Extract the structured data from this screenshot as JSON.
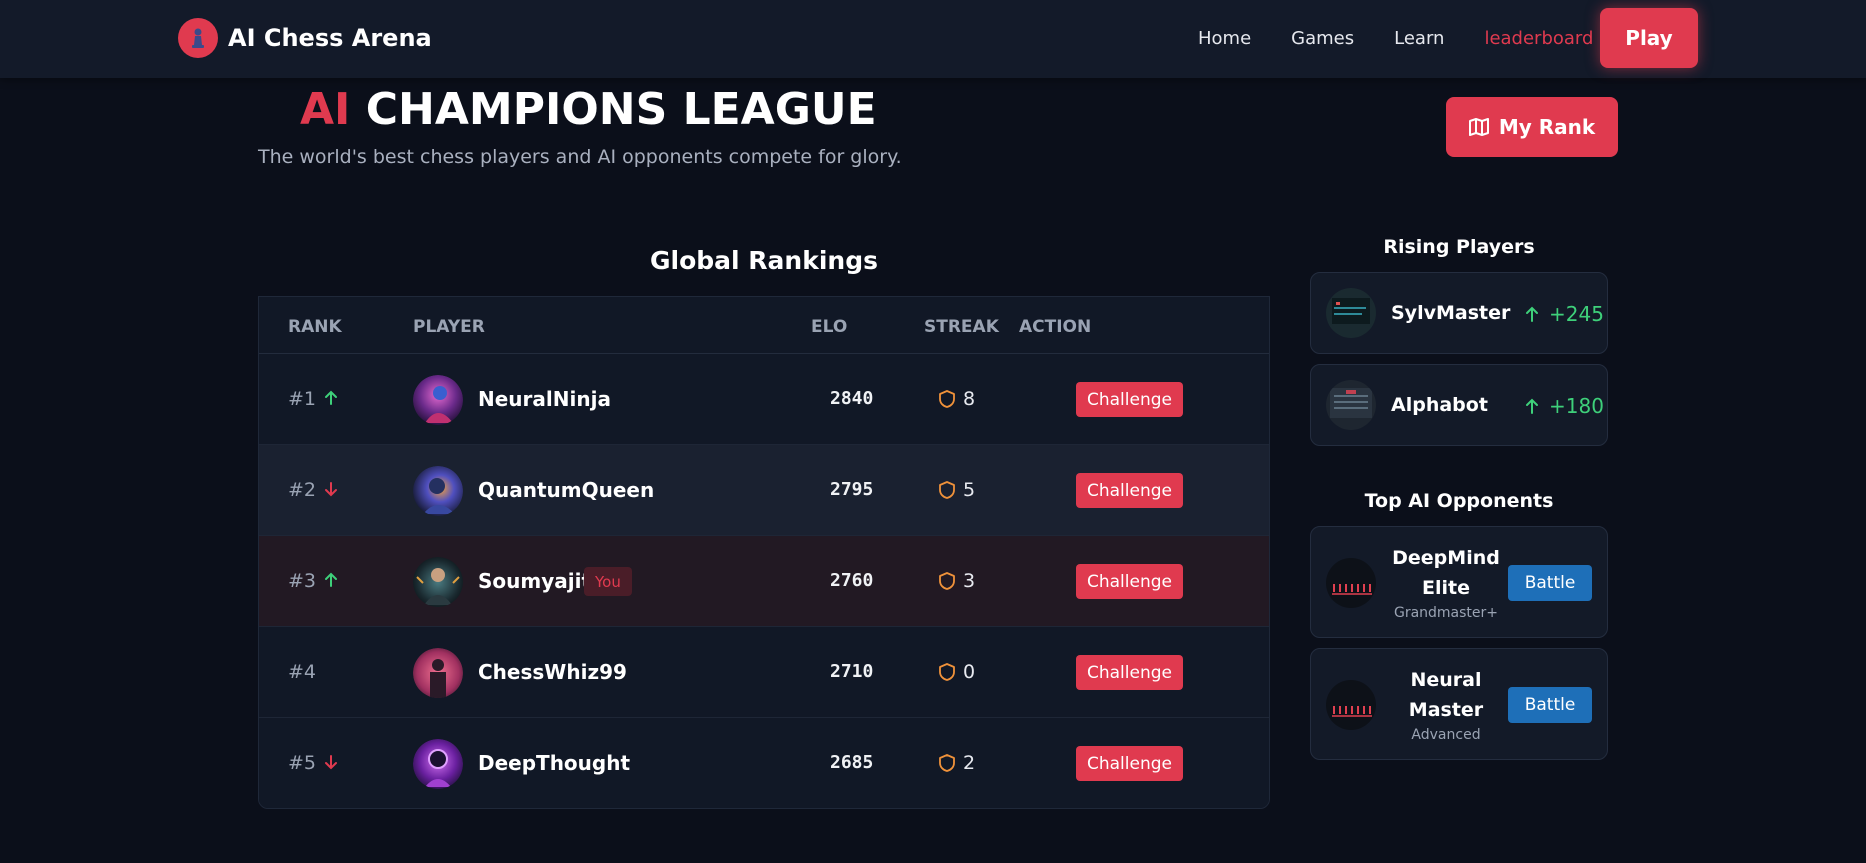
{
  "nav": {
    "brand": "AI Chess Arena",
    "links": [
      "Home",
      "Games",
      "Learn",
      "leaderboard"
    ],
    "play_label": "Play"
  },
  "hero": {
    "title_accent": "AI",
    "title_rest": "CHAMPIONS LEAGUE",
    "subtitle": "The world's best chess players and AI opponents compete for glory.",
    "my_rank_label": "My Rank"
  },
  "rankings": {
    "title": "Global Rankings",
    "columns": [
      "RANK",
      "PLAYER",
      "ELO",
      "STREAK",
      "ACTION"
    ],
    "rows": [
      {
        "rank": "#1",
        "trend": "up",
        "name": "NeuralNinja",
        "elo": "2840",
        "streak": "8",
        "action": "Challenge"
      },
      {
        "rank": "#2",
        "trend": "down",
        "name": "QuantumQueen",
        "elo": "2795",
        "streak": "5",
        "action": "Challenge"
      },
      {
        "rank": "#3",
        "trend": "up",
        "name": "Soumyajit",
        "badge": "You",
        "elo": "2760",
        "streak": "3",
        "action": "Challenge"
      },
      {
        "rank": "#4",
        "trend": "none",
        "name": "ChessWhiz99",
        "elo": "2710",
        "streak": "0",
        "action": "Challenge"
      },
      {
        "rank": "#5",
        "trend": "down",
        "name": "DeepThought",
        "elo": "2685",
        "streak": "2",
        "action": "Challenge"
      }
    ]
  },
  "rising": {
    "title": "Rising Players",
    "players": [
      {
        "name": "SylvMaster",
        "gain": "+245"
      },
      {
        "name": "Alphabot",
        "gain": "+180"
      }
    ]
  },
  "ai_opponents": {
    "title": "Top AI Opponents",
    "items": [
      {
        "name": "DeepMind Elite",
        "level": "Grandmaster+",
        "action": "Battle"
      },
      {
        "name": "Neural Master",
        "level": "Advanced",
        "action": "Battle"
      }
    ]
  },
  "colors": {
    "accent": "#e03a4f",
    "up": "#3ed07a",
    "down": "#e03a4f",
    "streak_icon": "#f0923a",
    "battle": "#1e6fb8"
  },
  "icons": {
    "brand": "chess-pawn-icon",
    "my_rank": "map-icon",
    "streak": "shield-icon",
    "trend_up": "arrow-up-icon",
    "trend_down": "arrow-down-icon"
  }
}
